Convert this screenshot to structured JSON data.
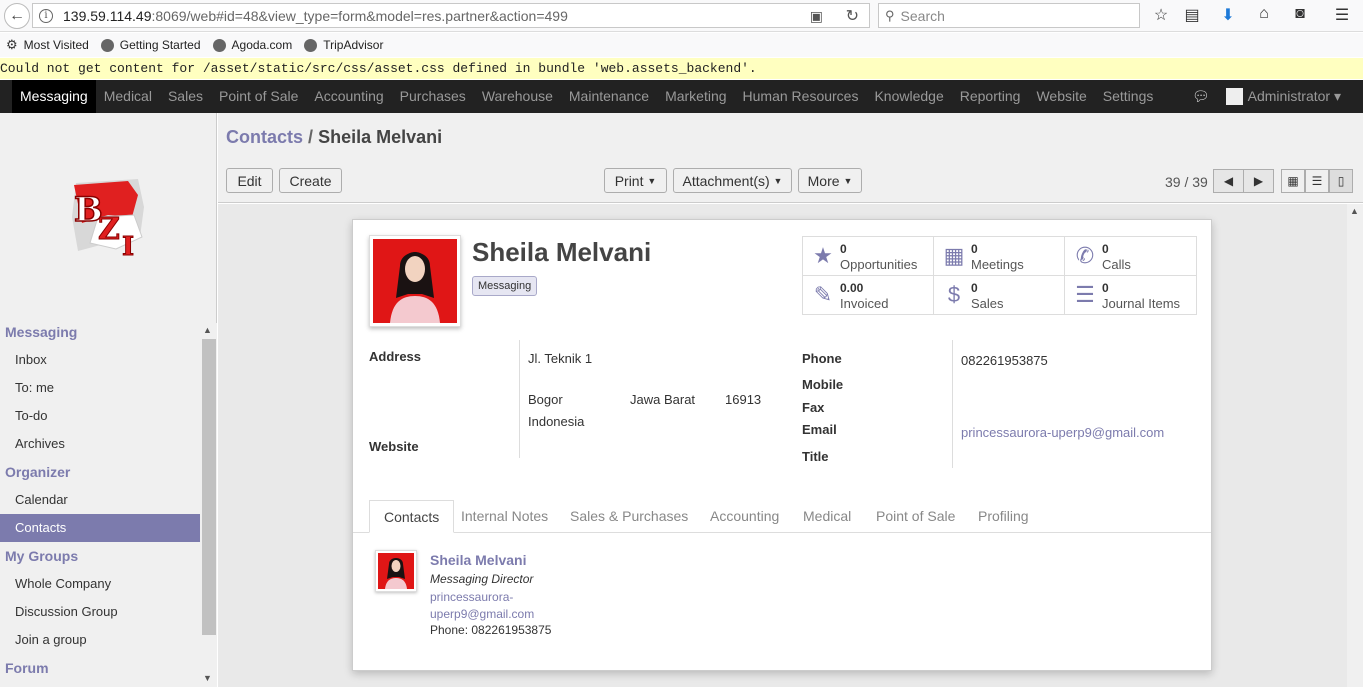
{
  "browser": {
    "url_host": "139.59.114.49",
    "url_rest": ":8069/web#id=48&view_type=form&model=res.partner&action=499",
    "search_placeholder": "Search",
    "bookmarks": [
      "Most Visited",
      "Getting Started",
      "Agoda.com",
      "TripAdvisor"
    ]
  },
  "error_message": "Could not get content for /asset/static/src/css/asset.css defined in bundle 'web.assets_backend'.",
  "topnav": {
    "menus": [
      "Messaging",
      "Medical",
      "Sales",
      "Point of Sale",
      "Accounting",
      "Purchases",
      "Warehouse",
      "Maintenance",
      "Marketing",
      "Human Resources",
      "Knowledge",
      "Reporting",
      "Website",
      "Settings"
    ],
    "active_menu": "Messaging",
    "user": "Administrator",
    "user_caret": "▾"
  },
  "logo_text": "BZI",
  "sidebar": {
    "sections": [
      {
        "title": "Messaging",
        "items": [
          "Inbox",
          "To: me",
          "To-do",
          "Archives"
        ]
      },
      {
        "title": "Organizer",
        "items": [
          "Calendar",
          "Contacts"
        ]
      },
      {
        "title": "My Groups",
        "items": [
          "Whole Company",
          "Discussion Group",
          "Join a group"
        ]
      },
      {
        "title": "Forum",
        "items": []
      }
    ],
    "active_item": "Contacts"
  },
  "control": {
    "breadcrumb_parent": "Contacts",
    "breadcrumb_sep": "/",
    "breadcrumb_current": "Sheila Melvani",
    "edit_label": "Edit",
    "create_label": "Create",
    "print_label": "Print",
    "attachments_label": "Attachment(s)",
    "more_label": "More",
    "pager": "39 / 39"
  },
  "partner": {
    "name": "Sheila Melvani",
    "tag": "Messaging",
    "stats": [
      {
        "icon": "star-icon",
        "glyph": "★",
        "value": "0",
        "label": "Opportunities"
      },
      {
        "icon": "calendar-icon",
        "glyph": "▦",
        "value": "0",
        "label": "Meetings"
      },
      {
        "icon": "phone-icon",
        "glyph": "✆",
        "value": "0",
        "label": "Calls"
      },
      {
        "icon": "edit-icon",
        "glyph": "✎",
        "value": "0.00",
        "label": "Invoiced"
      },
      {
        "icon": "dollar-icon",
        "glyph": "$",
        "value": "0",
        "label": "Sales"
      },
      {
        "icon": "list-icon",
        "glyph": "☰",
        "value": "0",
        "label": "Journal Items"
      }
    ],
    "labels": {
      "address": "Address",
      "website": "Website",
      "phone": "Phone",
      "mobile": "Mobile",
      "fax": "Fax",
      "email": "Email",
      "title": "Title"
    },
    "street": "Jl. Teknik 1",
    "city": "Bogor",
    "state": "Jawa Barat",
    "zip": "16913",
    "country": "Indonesia",
    "phone": "082261953875",
    "email": "princessaurora-uperp9@gmail.com"
  },
  "tabs": [
    "Contacts",
    "Internal Notes",
    "Sales & Purchases",
    "Accounting",
    "Medical",
    "Point of Sale",
    "Profiling"
  ],
  "active_tab": "Contacts",
  "contact_card": {
    "name": "Sheila Melvani",
    "function": "Messaging Director",
    "email_line1": "princessaurora-",
    "email_line2": "uperp9@gmail.com",
    "phone": "Phone: 082261953875"
  }
}
